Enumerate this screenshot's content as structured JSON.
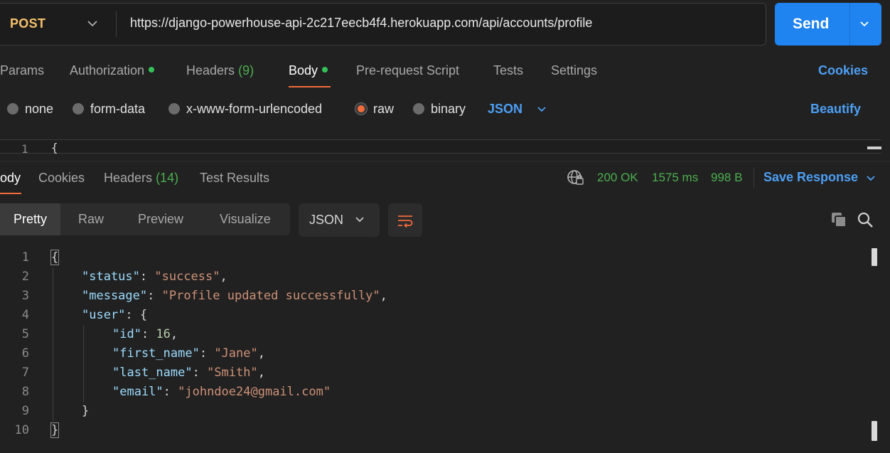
{
  "request": {
    "method": "POST",
    "url": "https://django-powerhouse-api-2c217eecb4f4.herokuapp.com/api/accounts/profile",
    "send_label": "Send"
  },
  "request_tabs": {
    "params": "Params",
    "authorization": "Authorization",
    "headers": "Headers",
    "headers_count": "(9)",
    "body": "Body",
    "pre_request": "Pre-request Script",
    "tests": "Tests",
    "settings": "Settings",
    "cookies": "Cookies"
  },
  "body_types": {
    "none": "none",
    "form_data": "form-data",
    "urlencoded": "x-www-form-urlencoded",
    "raw": "raw",
    "binary": "binary",
    "language": "JSON",
    "beautify": "Beautify",
    "selected": "raw"
  },
  "request_editor": {
    "line_number": "1",
    "text": "{"
  },
  "response_tabs": {
    "body": "ody",
    "cookies": "Cookies",
    "headers": "Headers",
    "headers_count": "(14)",
    "test_results": "Test Results"
  },
  "response_status": {
    "code": "200 OK",
    "time": "1575 ms",
    "size": "998 B",
    "save": "Save Response"
  },
  "view_modes": {
    "pretty": "Pretty",
    "raw": "Raw",
    "preview": "Preview",
    "visualize": "Visualize",
    "format": "JSON"
  },
  "response_body": {
    "line_numbers": [
      "1",
      "2",
      "3",
      "4",
      "5",
      "6",
      "7",
      "8",
      "9",
      "10"
    ],
    "open_brace": "{",
    "status_key": "\"status\"",
    "status_val": "\"success\"",
    "message_key": "\"message\"",
    "message_val": "\"Profile updated successfully\"",
    "user_key": "\"user\"",
    "id_key": "\"id\"",
    "id_val": "16",
    "first_name_key": "\"first_name\"",
    "first_name_val": "\"Jane\"",
    "last_name_key": "\"last_name\"",
    "last_name_val": "\"Smith\"",
    "email_key": "\"email\"",
    "email_val": "\"johndoe24@gmail.com\"",
    "inner_close": "}",
    "close_brace": "}"
  },
  "colors": {
    "accent": "#f26b3a",
    "primary_blue": "#1f83f0",
    "success_green": "#4caf50",
    "method_yellow": "#f5c16c"
  },
  "icons": [
    "chevron-down-icon",
    "globe-lock-icon",
    "wrap-lines-icon",
    "copy-icon",
    "search-icon"
  ]
}
